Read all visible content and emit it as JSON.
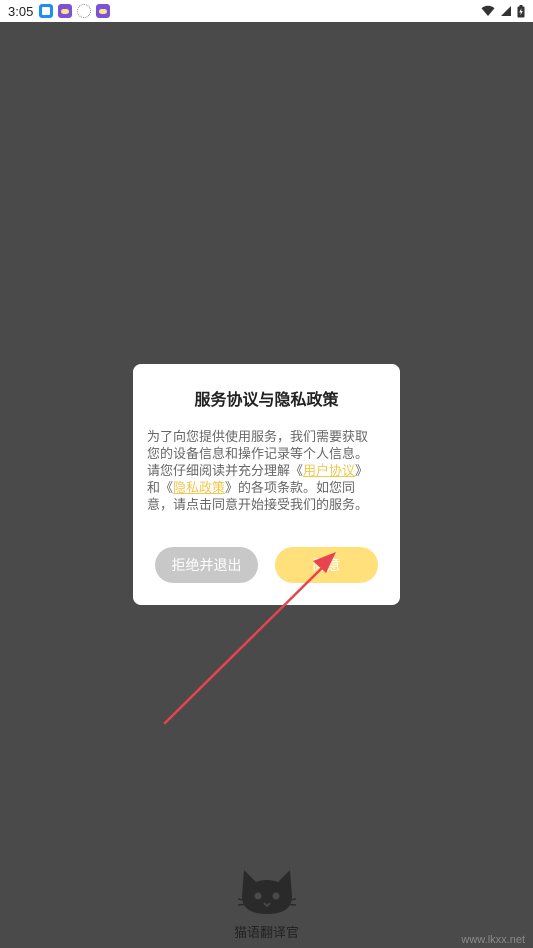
{
  "status_bar": {
    "time": "3:05"
  },
  "dialog": {
    "title": "服务协议与隐私政策",
    "body_intro": "为了向您提供使用服务，我们需要获取您的设备信息和操作记录等个人信息。请您仔细阅读并充分理解《",
    "user_agreement_link": "用户协议",
    "body_and": "》和《",
    "privacy_policy_link": "隐私政策",
    "body_outro": "》的各项条款。如您同意，请点击同意开始接受我们的服务。",
    "reject_label": "拒绝并退出",
    "agree_label": "同意"
  },
  "app": {
    "name": "猫语翻译官"
  },
  "watermark": "www.lkxx.net",
  "colors": {
    "overlay_bg": "#4a4a4a",
    "agree_button": "#ffe07a",
    "reject_button": "#c8c8c8",
    "link": "#f0c84e",
    "annotation_arrow": "#e8434e"
  }
}
